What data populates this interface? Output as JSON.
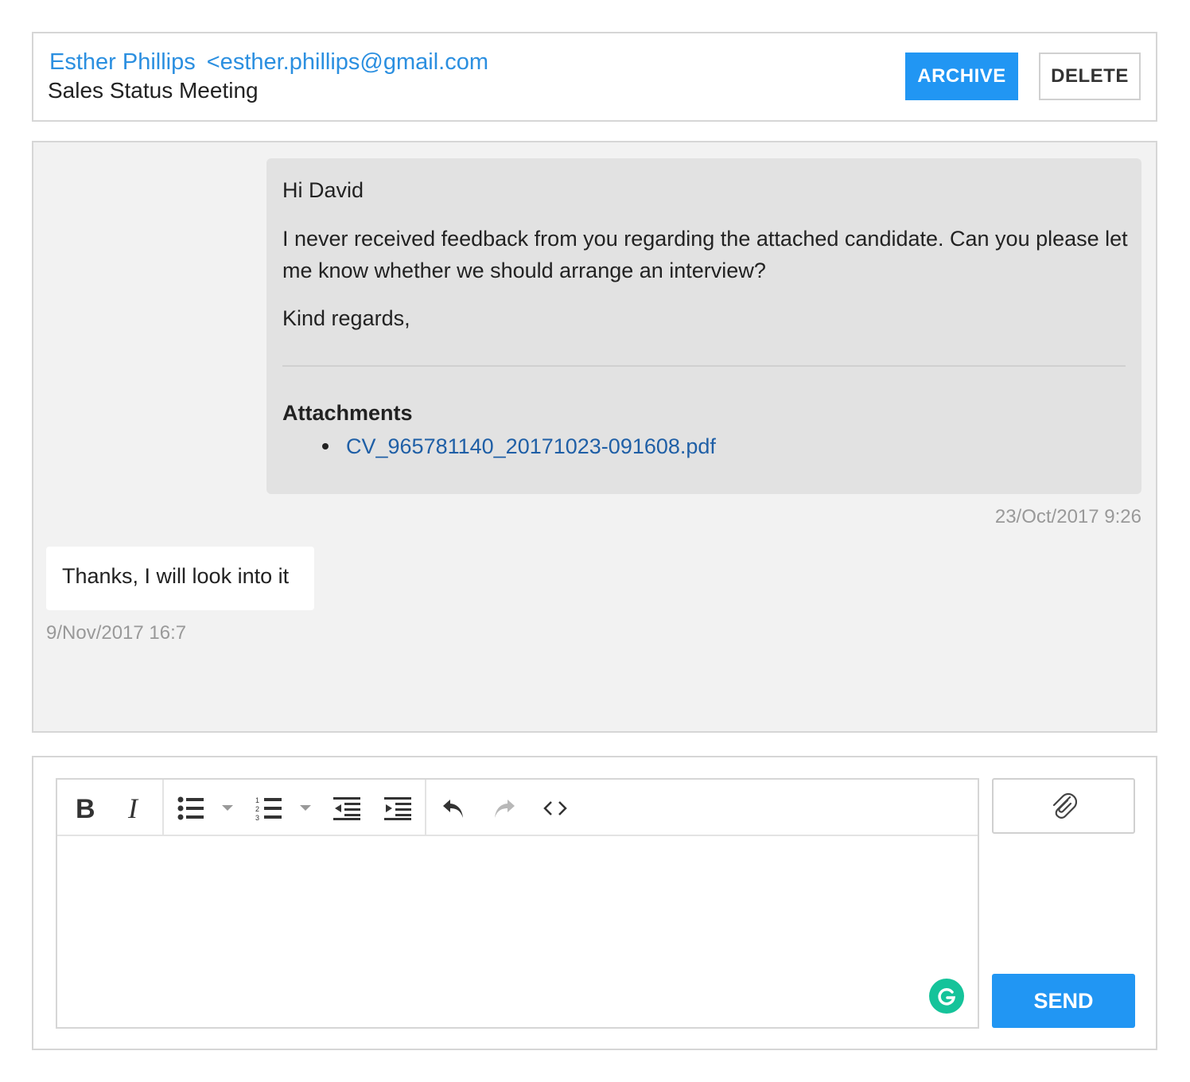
{
  "header": {
    "sender_name": "Esther Phillips",
    "sender_email": "<esther.phillips@gmail.com",
    "subject": "Sales Status Meeting",
    "archive_label": "ARCHIVE",
    "delete_label": "DELETE"
  },
  "conversation": {
    "incoming": {
      "greeting": "Hi David",
      "body": "I never received feedback from you regarding the attached candidate. Can you please let me know whether we should arrange an interview?",
      "closing": "Kind regards,",
      "attachments_title": "Attachments",
      "attachments": [
        "CV_965781140_20171023-091608.pdf"
      ],
      "timestamp": "23/Oct/2017 9:26"
    },
    "outgoing": {
      "text": "Thanks, I will look into it",
      "timestamp": "9/Nov/2017 16:7"
    }
  },
  "composer": {
    "toolbar": [
      "bold-icon",
      "italic-icon",
      "bullet-list-icon",
      "numbered-list-icon",
      "outdent-icon",
      "indent-icon",
      "undo-icon",
      "redo-icon",
      "code-icon"
    ],
    "send_label": "SEND",
    "attach_icon": "paperclip-icon"
  },
  "colors": {
    "accent": "#2196f3",
    "link": "#1f5fa6",
    "sender": "#2b8fe0",
    "grammarly": "#15c39a"
  }
}
